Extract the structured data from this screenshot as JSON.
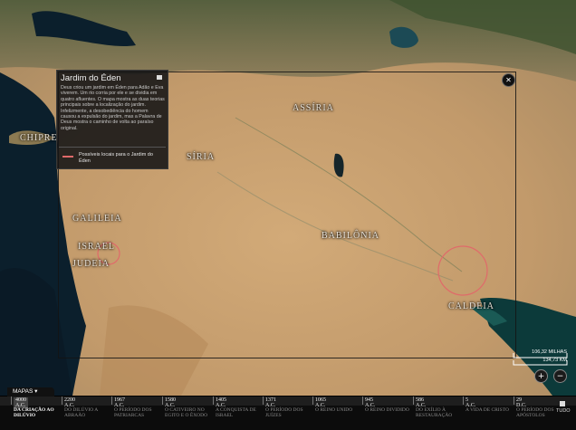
{
  "map": {
    "labels": {
      "chipre": "CHIPRE",
      "siria": "SÍRIA",
      "assiria": "ASSÍRIA",
      "galileia": "GALILEIA",
      "israel": "ISRAEL",
      "judeia": "JUDEIA",
      "babilonia": "BABILÔNIA",
      "caldeia": "CALDEIA"
    },
    "colors": {
      "sea": "#0b1f2c",
      "desert": "#c9a06f",
      "marker": "#e06a6a"
    }
  },
  "panel": {
    "title": "Jardim do Éden",
    "text": "Deus criou um jardim em Éden para Adão e Eva viverem. Um rio corria por ele e se dividia em quatro afluentes. O mapa mostra as duas teorias principais sobre a localização do jardim. Infelizmente, a desobediência do homem causou a expulsão do jardim, mas a Palavra de Deus mostra o caminho de volta ao paraíso original.",
    "legend": "Possíveis locais para o Jardim do Éden"
  },
  "controls": {
    "close_icon": "close-icon",
    "scale_miles": "106,32 MILHAS",
    "scale_km": "134,73 KM",
    "zoom_in": "+",
    "zoom_out": "−",
    "maps_button": "MAPAS ▾"
  },
  "timeline": {
    "eras": [
      {
        "year": "4000 A.C.",
        "label": "DA CRIAÇÃO AO DILÚVIO",
        "active": true
      },
      {
        "year": "2200 A.C.",
        "label": "DO DILÚVIO A ABRAÃO"
      },
      {
        "year": "1967 A.C.",
        "label": "O PERÍODO DOS PATRIARCAS"
      },
      {
        "year": "1580 A.C.",
        "label": "O CATIVEIRO NO EGITO E O ÊXODO"
      },
      {
        "year": "1405 A.C.",
        "label": "A CONQUISTA DE ISRAEL"
      },
      {
        "year": "1371 A.C.",
        "label": "O PERÍODO DOS JUÍZES"
      },
      {
        "year": "1065 A.C.",
        "label": "O REINO UNIDO"
      },
      {
        "year": "945 A.C.",
        "label": "O REINO DIVIDIDO"
      },
      {
        "year": "586 A.C.",
        "label": "DO EXÍLIO À RESTAURAÇÃO"
      },
      {
        "year": "5 A.C.",
        "label": "A VIDA DE CRISTO"
      },
      {
        "year": "29 D.C.",
        "label": "O PERÍODO DOS APÓSTOLOS"
      }
    ],
    "tudo": "TUDO"
  }
}
